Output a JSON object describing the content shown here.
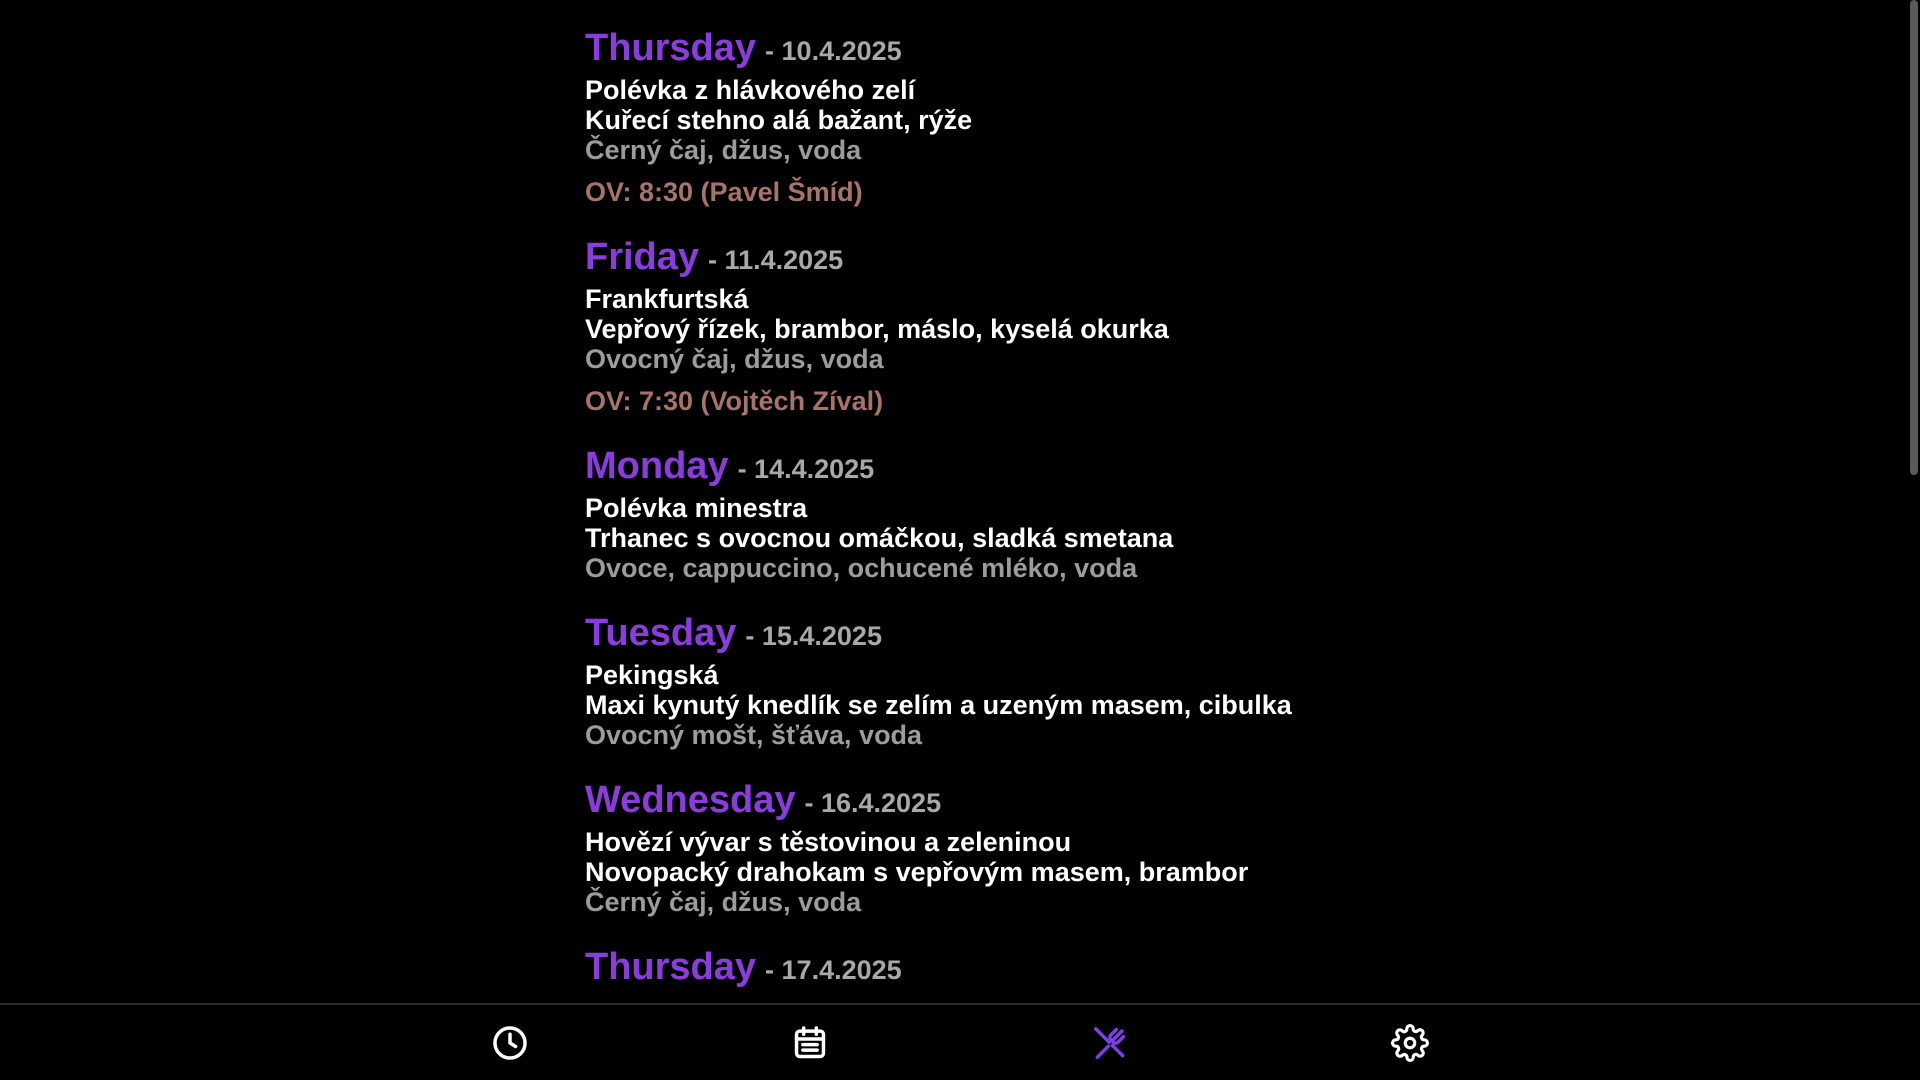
{
  "days": [
    {
      "name": "Thursday",
      "date": "- 10.4.2025",
      "soup": "Polévka z hlávkového zelí",
      "main": "Kuřecí stehno alá bažant, rýže",
      "drinks": "Černý čaj, džus, voda",
      "ov": "OV: 8:30 (Pavel Šmíd)"
    },
    {
      "name": "Friday",
      "date": "- 11.4.2025",
      "soup": "Frankfurtská",
      "main": "Vepřový řízek, brambor, máslo, kyselá okurka",
      "drinks": "Ovocný čaj, džus, voda",
      "ov": "OV: 7:30 (Vojtěch Zíval)"
    },
    {
      "name": "Monday",
      "date": "- 14.4.2025",
      "soup": "Polévka minestra",
      "main": "Trhanec s ovocnou omáčkou, sladká smetana",
      "drinks": "Ovoce, cappuccino, ochucené mléko, voda"
    },
    {
      "name": "Tuesday",
      "date": "- 15.4.2025",
      "soup": "Pekingská",
      "main": "Maxi kynutý knedlík se zelím a uzeným masem, cibulka",
      "drinks": "Ovocný mošt, šťáva, voda"
    },
    {
      "name": "Wednesday",
      "date": "- 16.4.2025",
      "soup": "Hovězí vývar s těstovinou a zeleninou",
      "main": "Novopacký drahokam s vepřovým masem, brambor",
      "drinks": "Černý čaj, džus, voda"
    },
    {
      "name": "Thursday",
      "date": "- 17.4.2025"
    }
  ],
  "nav": [
    {
      "icon": "clock-icon",
      "active": false
    },
    {
      "icon": "calendar-icon",
      "active": false
    },
    {
      "icon": "utensils-icon",
      "active": true
    },
    {
      "icon": "gear-icon",
      "active": false
    }
  ],
  "colors": {
    "background": "#000000",
    "day_name": "#8a3cdd",
    "date": "#a8a8a8",
    "dish": "#ffffff",
    "drinks": "#9c9c9c",
    "ov": "#a87368",
    "nav_icon": "#ffffff",
    "nav_active": "#7b3fe4"
  }
}
